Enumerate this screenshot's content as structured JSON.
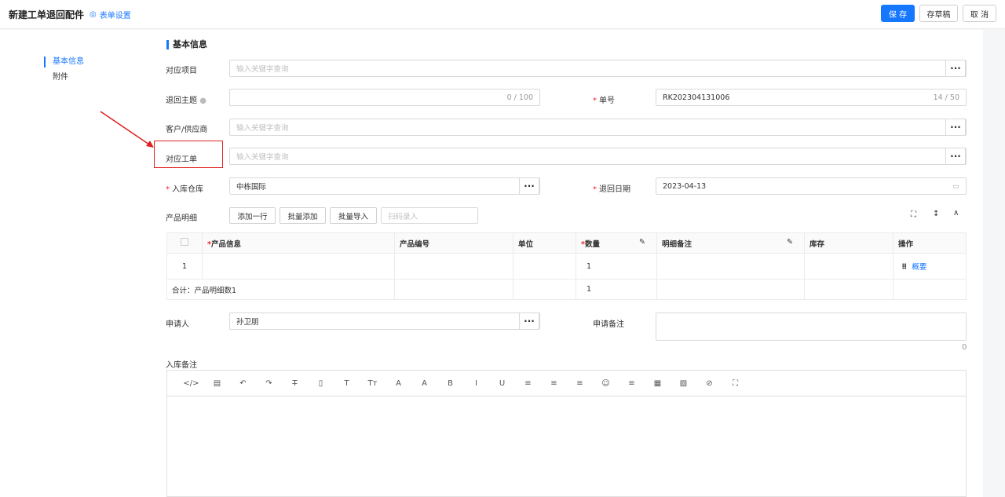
{
  "header": {
    "title": "新建工单退回配件",
    "form_settings": "表单设置",
    "save": "保 存",
    "draft": "存草稿",
    "cancel": "取 消"
  },
  "sidebar": {
    "items": [
      {
        "label": "基本信息"
      },
      {
        "label": "附件"
      }
    ]
  },
  "section": {
    "title": "基本信息"
  },
  "fields": {
    "project": {
      "label": "对应项目",
      "placeholder": "输入关键字查询"
    },
    "subject": {
      "label": "退回主题",
      "count": "0 / 100"
    },
    "number": {
      "label": "单号",
      "value": "RK202304131006",
      "count": "14 / 50"
    },
    "customer": {
      "label": "客户/供应商",
      "placeholder": "输入关键字查询"
    },
    "workorder": {
      "label": "对应工单",
      "placeholder": "输入关键字查询"
    },
    "warehouse": {
      "label": "入库仓库",
      "value": "中栋国际"
    },
    "return_date": {
      "label": "退回日期",
      "value": "2023-04-13"
    },
    "products": {
      "label": "产品明细",
      "add_row": "添加一行",
      "batch_add": "批量添加",
      "batch_import": "批量导入",
      "scan_placeholder": "扫码录入"
    },
    "applicant": {
      "label": "申请人",
      "value": "孙卫朋"
    },
    "apply_note": {
      "label": "申请备注",
      "count": "0"
    },
    "stock_note": {
      "label": "入库备注"
    }
  },
  "table": {
    "headers": [
      "",
      "产品信息",
      "产品编号",
      "单位",
      "数量",
      "明细备注",
      "库存",
      "操作"
    ],
    "rows": [
      {
        "index": "1",
        "quantity": "1",
        "action": "概要"
      }
    ],
    "summary": {
      "label": "合计：产品明细数1",
      "quantity": "1"
    }
  },
  "toolbar_icons": [
    "code-icon",
    "table-icon",
    "undo-icon",
    "redo-icon",
    "strikethrough-icon",
    "file-icon",
    "text-icon",
    "font-size-icon",
    "font-color-icon",
    "bg-color-icon",
    "bold-icon",
    "italic-icon",
    "underline-icon",
    "align-left-icon",
    "align-center-icon",
    "align-right-icon",
    "emoji-icon",
    "hr-icon",
    "grid-icon",
    "image-icon",
    "attach-icon",
    "fullscreen-icon"
  ],
  "toolbar_glyphs": [
    "</>",
    "▤",
    "↶",
    "↷",
    "T̶",
    "▯",
    "T",
    "Tт",
    "A",
    "A",
    "B",
    "I",
    "U",
    "≡",
    "≡",
    "≡",
    "☺",
    "≡",
    "▦",
    "▨",
    "⊘",
    "⛶"
  ],
  "colors": {
    "accent": "#1677ff",
    "annotation": "#e02020"
  }
}
